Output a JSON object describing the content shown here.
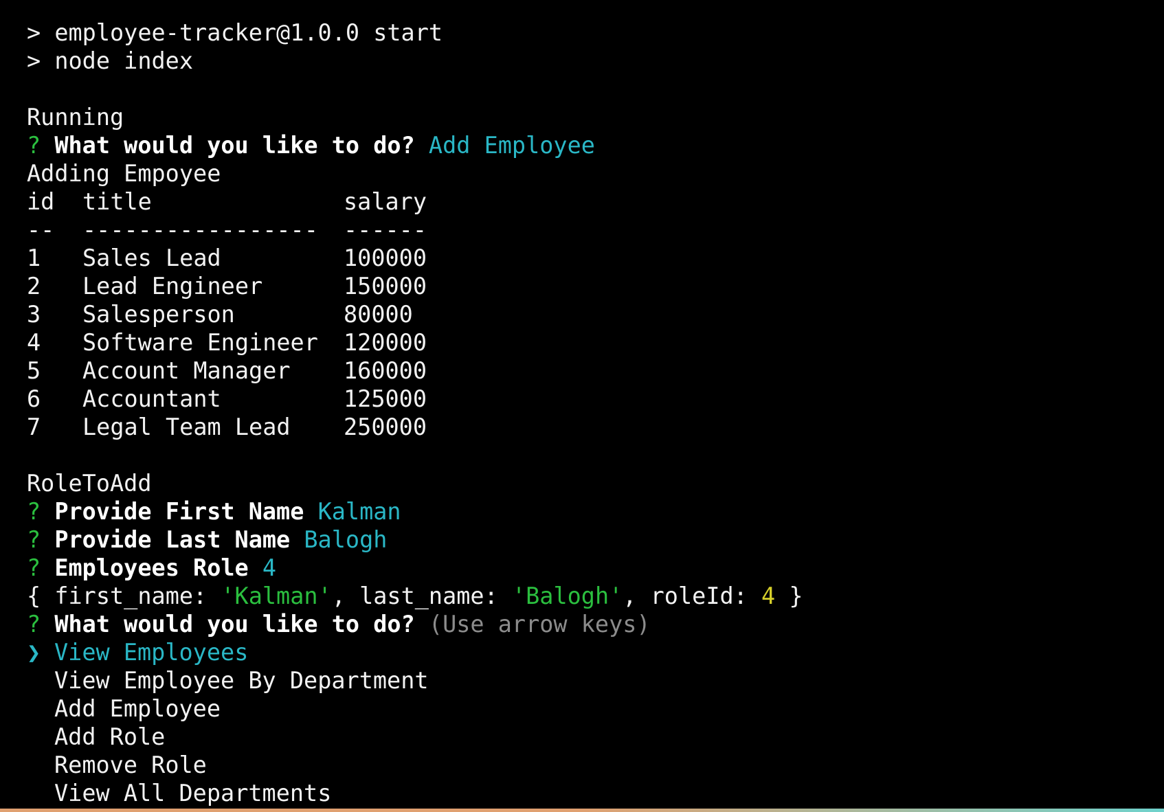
{
  "colors": {
    "background": "#000000",
    "text": "#f2f2f2",
    "prompt_mark": "#2bbf3f",
    "answer": "#2ab7c6",
    "string_literal": "#2bbf3f",
    "number_literal": "#d6cf2a",
    "hint": "#8c8c8c"
  },
  "npm": {
    "line1": "> employee-tracker@1.0.0 start",
    "line2": "> node index"
  },
  "running": "Running",
  "prompt_mark": "?",
  "q1": {
    "question": "What would you like to do?",
    "answer": "Add Employee"
  },
  "adding": "Adding Empoyee",
  "table": {
    "headers": {
      "id": "id",
      "title": "title",
      "salary": "salary"
    },
    "separators": {
      "id": "--",
      "title": "-----------------",
      "salary": "------"
    },
    "rows": [
      {
        "id": "1",
        "title": "Sales Lead",
        "salary": "100000"
      },
      {
        "id": "2",
        "title": "Lead Engineer",
        "salary": "150000"
      },
      {
        "id": "3",
        "title": "Salesperson",
        "salary": "80000"
      },
      {
        "id": "4",
        "title": "Software Engineer",
        "salary": "120000"
      },
      {
        "id": "5",
        "title": "Account Manager",
        "salary": "160000"
      },
      {
        "id": "6",
        "title": "Accountant",
        "salary": "125000"
      },
      {
        "id": "7",
        "title": "Legal Team Lead",
        "salary": "250000"
      }
    ]
  },
  "role_to_add": "RoleToAdd",
  "first_name_prompt": {
    "question": "Provide First Name",
    "answer": "Kalman"
  },
  "last_name_prompt": {
    "question": "Provide Last Name",
    "answer": "Balogh"
  },
  "role_prompt": {
    "question": "Employees Role",
    "answer": "4"
  },
  "object_log": {
    "open": "{ ",
    "key1": "first_name: ",
    "val1": "'Kalman'",
    "sep1": ", ",
    "key2": "last_name: ",
    "val2": "'Balogh'",
    "sep2": ", ",
    "key3": "roleId: ",
    "val3": "4",
    "close": " }"
  },
  "q2": {
    "question": "What would you like to do?",
    "hint": "(Use arrow keys)"
  },
  "menu": {
    "pointer": "❯",
    "selected": "View Employees",
    "options": [
      "View Employee By Department",
      "Add Employee",
      "Add Role",
      "Remove Role",
      "View All Departments"
    ]
  }
}
